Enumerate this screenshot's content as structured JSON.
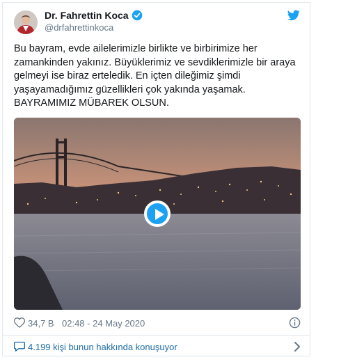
{
  "author": {
    "name": "Dr. Fahrettin Koca",
    "handle": "@drfahrettinkoca",
    "verified": true,
    "avatar_icon": "profile-photo"
  },
  "platform_icon": "twitter-bird-icon",
  "tweet": {
    "lines": [
      "Bu bayram, evde ailelerimizle birlikte ve birbirimize her",
      "zamankinden yakınız. Büyüklerimiz ve sevdiklerimizle bir araya",
      "gelmeyi ise biraz erteledik. En içten dileğimiz şimdi",
      "yaşayamadığımız güzellikleri çok yakında yaşamak.",
      "BAYRAMIMIZ MÜBAREK OLSUN."
    ]
  },
  "media": {
    "type": "video",
    "play_icon": "play-icon"
  },
  "meta": {
    "likes": "34,7 B",
    "timestamp": "02:48 - 24 May 2020"
  },
  "conversation": {
    "label": "4.199 kişi bunun hakkında konuşuyor"
  },
  "colors": {
    "accent": "#1da1f2",
    "link": "#1b6aa5",
    "muted": "#657786",
    "border": "#e1e8ed"
  }
}
